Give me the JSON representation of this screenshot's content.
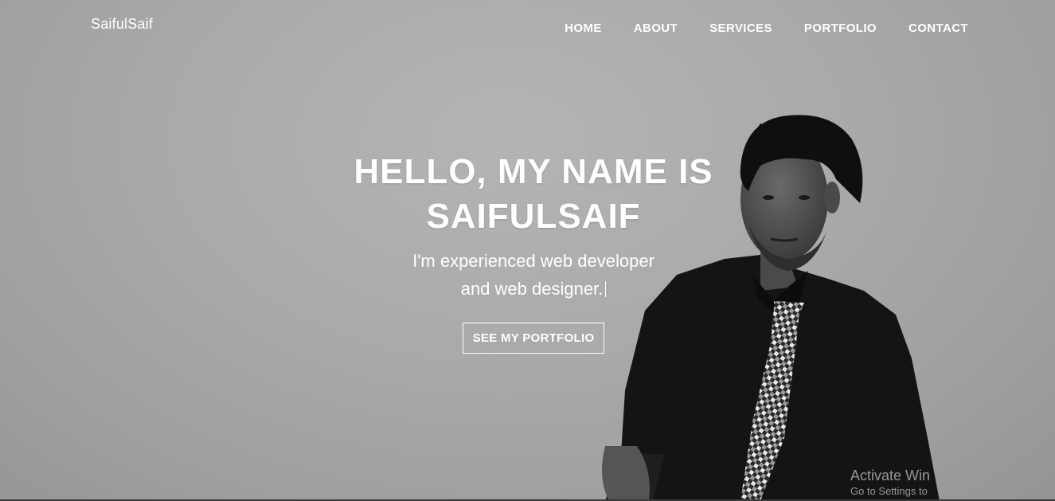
{
  "brand": "SaifulSaif",
  "nav": {
    "items": [
      {
        "label": "HOME"
      },
      {
        "label": "ABOUT"
      },
      {
        "label": "SERVICES"
      },
      {
        "label": "PORTFOLIO"
      },
      {
        "label": "CONTACT"
      }
    ]
  },
  "hero": {
    "title": "HELLO, MY NAME IS SAIFULSAIF",
    "subtitle_line1": "I'm experienced web developer",
    "subtitle_line2": "and web designer.",
    "cta_label": "SEE MY PORTFOLIO"
  },
  "watermark": {
    "title": "Activate Win",
    "subtitle": "Go to Settings to"
  },
  "colors": {
    "text": "#ffffff",
    "background": "#a9a9a9"
  }
}
